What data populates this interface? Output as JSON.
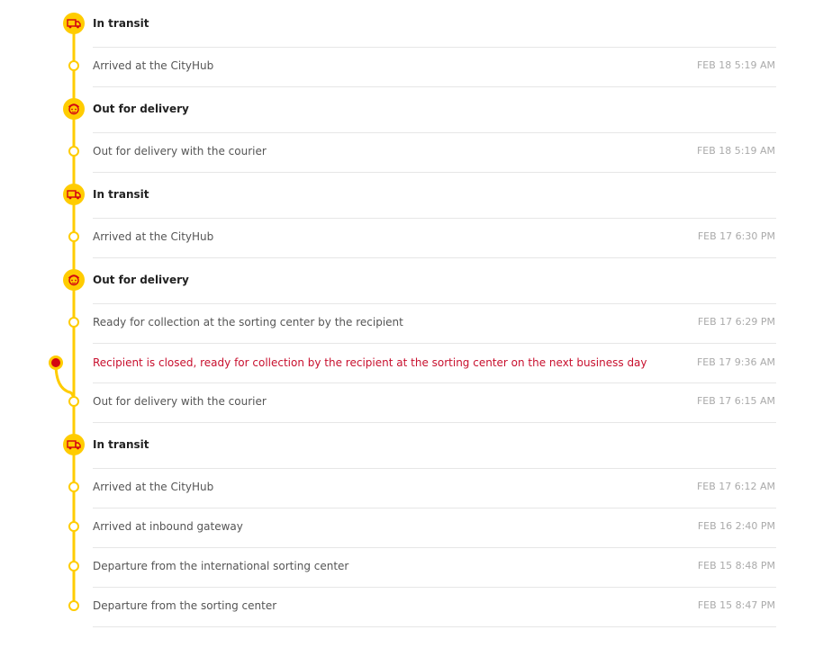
{
  "timeline": {
    "entries": [
      {
        "kind": "header",
        "title": "In transit",
        "icon": "truck-icon"
      },
      {
        "kind": "event",
        "text": "Arrived at the CityHub",
        "time": "FEB 18 5:19 AM"
      },
      {
        "kind": "header",
        "title": "Out for delivery",
        "icon": "courier-icon"
      },
      {
        "kind": "event",
        "text": "Out for delivery with the courier",
        "time": "FEB 18 5:19 AM"
      },
      {
        "kind": "header",
        "title": "In transit",
        "icon": "truck-icon"
      },
      {
        "kind": "event",
        "text": "Arrived at the CityHub",
        "time": "FEB 17 6:30 PM"
      },
      {
        "kind": "header",
        "title": "Out for delivery",
        "icon": "courier-icon"
      },
      {
        "kind": "event",
        "text": "Ready for collection at the sorting center by the recipient",
        "time": "FEB 17 6:29 PM"
      },
      {
        "kind": "exception",
        "text": "Recipient is closed, ready for collection by the recipient at the sorting center on the next business day",
        "time": "FEB 17 9:36 AM"
      },
      {
        "kind": "event",
        "text": "Out for delivery with the courier",
        "time": "FEB 17 6:15 AM"
      },
      {
        "kind": "header",
        "title": "In transit",
        "icon": "truck-icon"
      },
      {
        "kind": "event",
        "text": "Arrived at the CityHub",
        "time": "FEB 17 6:12 AM"
      },
      {
        "kind": "event",
        "text": "Arrived at inbound gateway",
        "time": "FEB 16 2:40 PM"
      },
      {
        "kind": "event",
        "text": "Departure from the international sorting center",
        "time": "FEB 15 8:48 PM"
      },
      {
        "kind": "event",
        "text": "Departure from the sorting center",
        "time": "FEB 15 8:47 PM"
      }
    ]
  },
  "colors": {
    "rail": "#ffcc00",
    "icon_accent": "#d40511",
    "exception_text": "#c8102e",
    "divider": "#e6e6e6"
  }
}
